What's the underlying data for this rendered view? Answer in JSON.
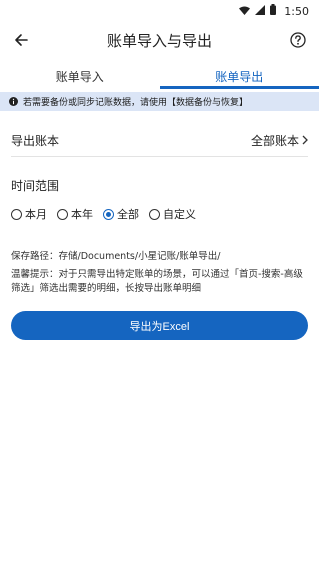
{
  "status_bar": {
    "time": "1:50"
  },
  "app_bar": {
    "title": "账单导入与导出"
  },
  "tabs": [
    {
      "label": "账单导入",
      "active": false
    },
    {
      "label": "账单导出",
      "active": true
    }
  ],
  "notice": {
    "text": "若需要备份或同步记账数据，请使用【数据备份与恢复】"
  },
  "export_books": {
    "label": "导出账本",
    "value": "全部账本"
  },
  "time_range": {
    "label": "时间范围",
    "options": [
      "本月",
      "本年",
      "全部",
      "自定义"
    ],
    "selected": "全部"
  },
  "save_path": "保存路径：存储/Documents/小星记账/账单导出/",
  "tip": "温馨提示：对于只需导出特定账单的场景，可以通过「首页-搜索-高级筛选」筛选出需要的明细，长按导出账单明细",
  "export_button": {
    "label": "导出为Excel"
  },
  "colors": {
    "accent": "#1565c0",
    "notice_bg": "#dbe5f6"
  }
}
